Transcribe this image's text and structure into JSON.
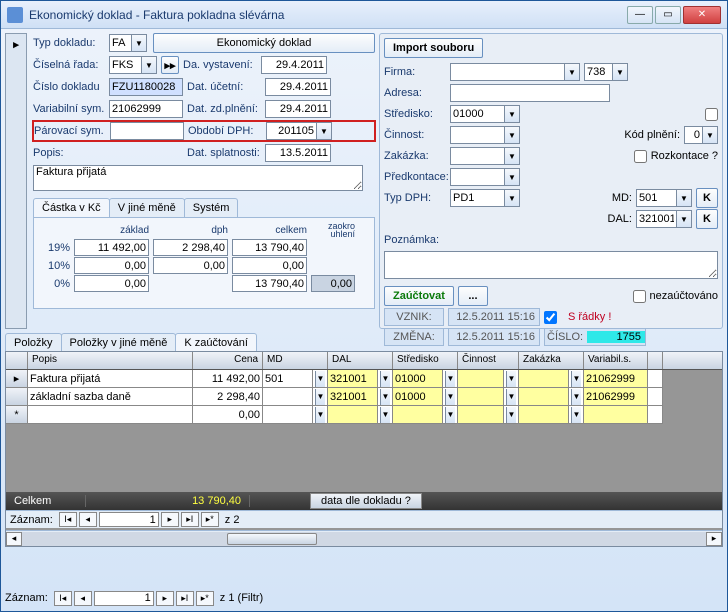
{
  "window": {
    "title": "Ekonomický doklad - Faktura pokladna slévárna"
  },
  "topLeft": {
    "typDokladu_lbl": "Typ dokladu:",
    "typDokladu": "FA",
    "ekonBtn": "Ekonomický doklad",
    "cisRada_lbl": "Číselná řada:",
    "cisRada": "FKS",
    "cisloDok_lbl": "Číslo dokladu",
    "cisloDok": "FZU1180028",
    "varSym_lbl": "Variabilní sym.",
    "varSym": "21062999",
    "parSym_lbl": "Párovací sym.",
    "parSym": "",
    "popis_lbl": "Popis:",
    "popis": "Faktura přijatá"
  },
  "dates": {
    "daVyst_lbl": "Da. vystavení:",
    "daVyst": "29.4.2011",
    "datUcet_lbl": "Dat. účetní:",
    "datUcet": "29.4.2011",
    "datZd_lbl": "Dat. zd.plnění:",
    "datZd": "29.4.2011",
    "obdDph_lbl": "Období DPH:",
    "obdDph": "201105",
    "datSpl_lbl": "Dat. splatnosti:",
    "datSpl": "13.5.2011"
  },
  "right": {
    "importBtn": "Import souboru",
    "firma_lbl": "Firma:",
    "firma": "",
    "firma_num": "738",
    "adresa_lbl": "Adresa:",
    "adresa": "",
    "stred_lbl": "Středisko:",
    "stred": "01000",
    "cinn_lbl": "Činnost:",
    "cinn": "",
    "zakaz_lbl": "Zakázka:",
    "zakaz": "",
    "kodpl_lbl": "Kód plnění:",
    "kodpl": "0",
    "predk_lbl": "Předkontace:",
    "predk": "",
    "rozkont": "Rozkontace ?",
    "typDph_lbl": "Typ DPH:",
    "typDph": "PD1",
    "md_lbl": "MD:",
    "md": "501",
    "k": "K",
    "dal_lbl": "DAL:",
    "dal": "321001",
    "pozn_lbl": "Poznámka:",
    "zauc_btn": "Zaúčtovat",
    "dots_btn": "...",
    "nezauc": "nezaúčtováno",
    "sradky": "S řádky !",
    "vznik_lbl": "VZNIK:",
    "vznik": "12.5.2011 15:16",
    "zmena_lbl": "ZMĚNA:",
    "zmena": "12.5.2011 15:16",
    "cislo_lbl": "ČÍSLO:",
    "cislo": "1755"
  },
  "amountTabs": {
    "t1": "Částka v Kč",
    "t2": "V jiné měně",
    "t3": "Systém"
  },
  "amounts": {
    "h_zaklad": "základ",
    "h_dph": "dph",
    "h_celkem": "celkem",
    "h_zaokr": "zaokro\nuhlení",
    "r19": "19%",
    "r10": "10%",
    "r0": "0%",
    "z19": "11 492,00",
    "d19": "2 298,40",
    "c19": "13 790,40",
    "z10": "0,00",
    "d10": "0,00",
    "c10": "0,00",
    "z0": "0,00",
    "c0": "13 790,40",
    "zaokr": "0,00"
  },
  "lowerTabs": {
    "t1": "Položky",
    "t2": "Položky v jiné měně",
    "t3": "K zaúčtování"
  },
  "gridHead": {
    "popis": "Popis",
    "cena": "Cena",
    "md": "MD",
    "dal": "DAL",
    "stred": "Středisko",
    "cinn": "Činnost",
    "zakaz": "Zakázka",
    "varsym": "Variabil.s."
  },
  "gridRows": [
    {
      "popis": "Faktura přijatá",
      "cena": "11 492,00",
      "md": "501",
      "dal": "321001",
      "stred": "01000",
      "cinn": "",
      "zakaz": "",
      "varsym": "21062999"
    },
    {
      "popis": "základní sazba daně",
      "cena": "2 298,40",
      "md": "",
      "dal": "321001",
      "stred": "01000",
      "cinn": "",
      "zakaz": "",
      "varsym": "21062999"
    },
    {
      "popis": "",
      "cena": "0,00",
      "md": "",
      "dal": "",
      "stred": "",
      "cinn": "",
      "zakaz": "",
      "varsym": ""
    }
  ],
  "footer": {
    "celkem_lbl": "Celkem",
    "celkem": "13 790,40",
    "dataDle": "data dle dokladu ?"
  },
  "nav": {
    "zaznam": "Záznam:",
    "pos": "1",
    "total": "z  2",
    "filtr": "z  1 (Filtr)"
  }
}
